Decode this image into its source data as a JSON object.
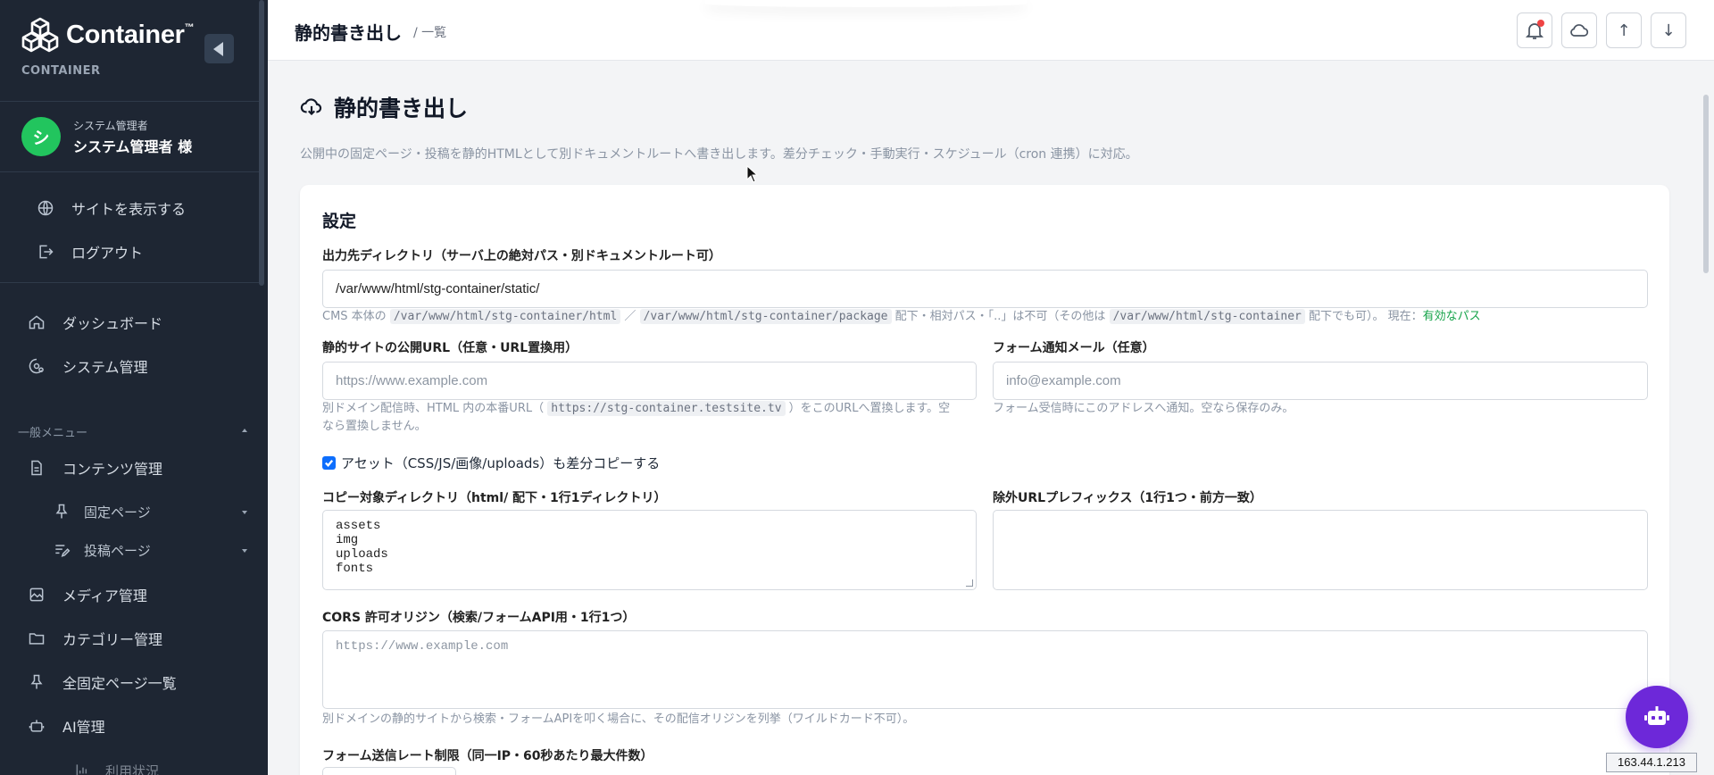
{
  "sidebar": {
    "brand_name": "Container",
    "brand_tm": "™",
    "brand_sub": "CONTAINER",
    "user": {
      "avatar_letter": "シ",
      "role": "システム管理者",
      "name": "システム管理者 様"
    },
    "top_links": [
      {
        "label": "サイトを表示する",
        "icon": "globe-icon"
      },
      {
        "label": "ログアウト",
        "icon": "logout-icon"
      }
    ],
    "main_items": [
      {
        "label": "ダッシュボード",
        "icon": "home-icon"
      },
      {
        "label": "システム管理",
        "icon": "settings-icon"
      }
    ],
    "section_label": "一般メニュー",
    "menu": {
      "content": "コンテンツ管理",
      "fixed_pages": "固定ページ",
      "posts": "投稿ページ",
      "media": "メディア管理",
      "category": "カテゴリー管理",
      "all_fixed": "全固定ページ一覧",
      "ai": "AI管理",
      "usage": "利用状況"
    }
  },
  "topbar": {
    "title": "静的書き出し",
    "breadcrumb": "/ 一覧",
    "buttons": [
      "bell-icon",
      "cloud-icon",
      "arrow-up-icon",
      "arrow-down-icon"
    ],
    "up_glyph": "↑",
    "down_glyph": "↓"
  },
  "main": {
    "heading": "静的書き出し",
    "description": "公開中の固定ページ・投稿を静的HTMLとして別ドキュメントルートへ書き出します。差分チェック・手動実行・スケジュール（cron 連携）に対応。",
    "card_title": "設定",
    "output_dir": {
      "label": "出力先ディレクトリ（サーバ上の絶対パス・別ドキュメントルート可）",
      "value": "/var/www/html/stg-container/static/",
      "help_pre": "CMS 本体の",
      "path1": "/var/www/html/stg-container/html",
      "sep": "／",
      "path2": "/var/www/html/stg-container/package",
      "help_mid": "配下・相対パス・「..」は不可（その他は",
      "path3": "/var/www/html/stg-container",
      "help_post": "配下でも可）。 現在：",
      "status": "有効なパス"
    },
    "public_url": {
      "label": "静的サイトの公開URL（任意・URL置換用）",
      "placeholder": "https://www.example.com",
      "help_pre": "別ドメイン配信時、HTML 内の本番URL（",
      "code": "https://stg-container.testsite.tv",
      "help_post_1": "）をこのURLへ置換します。空",
      "help_post_2": "なら置換しません。"
    },
    "notify_mail": {
      "label": "フォーム通知メール（任意）",
      "placeholder": "info@example.com",
      "help": "フォーム受信時にこのアドレスへ通知。空なら保存のみ。"
    },
    "copy_assets": {
      "label": "アセット（CSS/JS/画像/uploads）も差分コピーする",
      "checked": true
    },
    "copy_dirs": {
      "label": "コピー対象ディレクトリ（html/ 配下・1行1ディレクトリ）",
      "lines": [
        "assets",
        "img",
        "uploads",
        "fonts"
      ]
    },
    "exclude_prefix": {
      "label": "除外URLプレフィックス（1行1つ・前方一致）",
      "value": ""
    },
    "cors": {
      "label": "CORS 許可オリジン（検索/フォームAPI用・1行1つ）",
      "placeholder": "https://www.example.com",
      "help": "別ドメインの静的サイトから検索・フォームAPIを叩く場合に、その配信オリジンを列挙（ワイルドカード不可）。"
    },
    "rate_limit": {
      "label": "フォーム送信レート制限（同一IP・60秒あたり最大件数）"
    }
  },
  "ip_badge": "163.44.1.213",
  "colors": {
    "sidebar": "#1e2633",
    "accent": "#6d28d9",
    "success": "#16a34a",
    "primary": "#0d6efd"
  }
}
